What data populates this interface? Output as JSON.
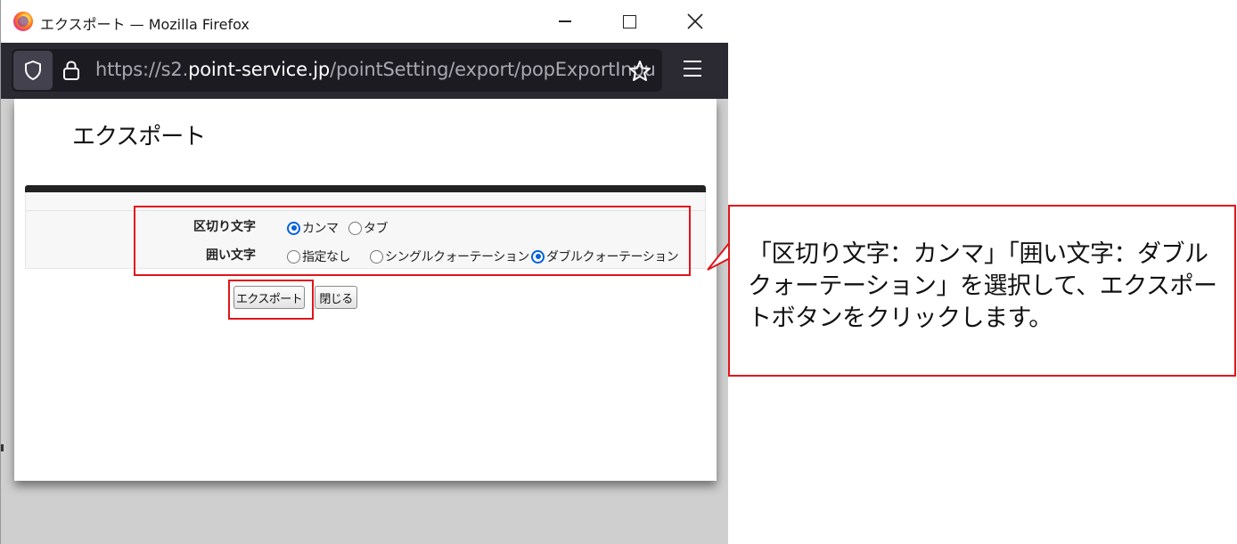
{
  "window": {
    "title": "エクスポート — Mozilla Firefox",
    "url_prefix": "https://s2.",
    "url_host": "point-service.jp",
    "url_path": "/pointSetting/export/popExportInpu"
  },
  "page": {
    "title": "エクスポート",
    "delimiter": {
      "label": "区切り文字",
      "options": [
        "カンマ",
        "タブ"
      ],
      "selected": "カンマ"
    },
    "enclosure": {
      "label": "囲い文字",
      "options": [
        "指定なし",
        "シングルクォーテーション",
        "ダブルクォーテーション"
      ],
      "selected": "ダブルクォーテーション"
    },
    "export_button": "エクスポート",
    "close_button": "閉じる"
  },
  "callout": {
    "text": "「区切り文字：カンマ」「囲い文字：ダブルクォーテーション」を選択して、エクスポートボタンをクリックします。"
  },
  "colors": {
    "highlight": "#e0151c",
    "radio_selected": "#0060df",
    "toolbar": "#2b2a33"
  },
  "icons": {
    "app": "firefox-logo-icon",
    "shield": "shield-icon",
    "lock": "lock-icon",
    "bookmark": "star-icon",
    "menu": "hamburger-menu-icon"
  }
}
